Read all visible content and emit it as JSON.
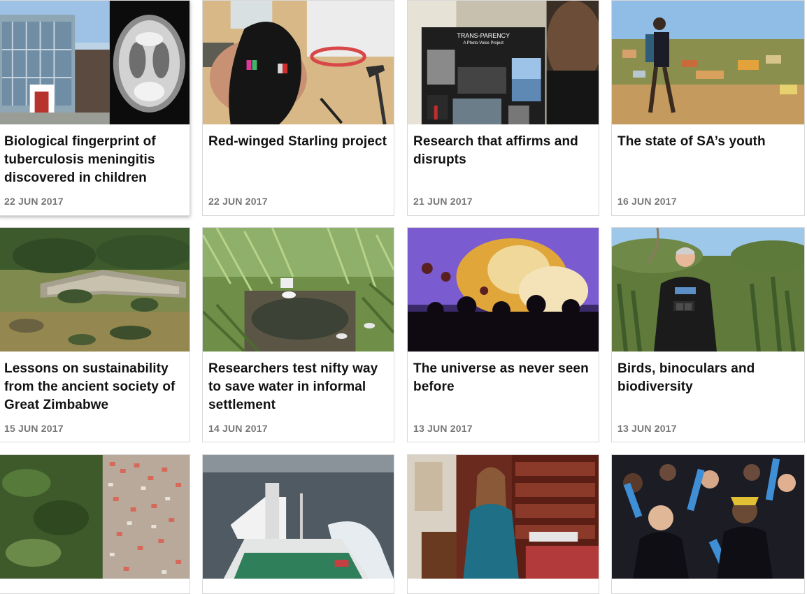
{
  "articles": [
    {
      "title": "Biological fingerprint of tuberculosis meningitis discovered in children",
      "date": "22 JUN 2017",
      "image": "building-and-brain-mri"
    },
    {
      "title": "Red-winged Starling project",
      "date": "22 JUN 2017",
      "image": "bird-in-hand-with-ringing-tools"
    },
    {
      "title": "Research that affirms and disrupts",
      "date": "21 JUN 2017",
      "image": "photo-voice-poster"
    },
    {
      "title": "The state of SA’s youth",
      "date": "16 JUN 2017",
      "image": "child-walking-on-hillside"
    },
    {
      "title": "Lessons on sustainability from the ancient society of Great Zimbabwe",
      "date": "15 JUN 2017",
      "image": "great-zimbabwe-ruins"
    },
    {
      "title": "Researchers test nifty way to save water in informal settlement",
      "date": "14 JUN 2017",
      "image": "grass-and-wastewater"
    },
    {
      "title": "The universe as never seen before",
      "date": "13 JUN 2017",
      "image": "planetarium-audience"
    },
    {
      "title": "Birds, binoculars and biodiversity",
      "date": "13 JUN 2017",
      "image": "man-with-binoculars"
    },
    {
      "image": "aerial-township-and-forest"
    },
    {
      "image": "research-vessel-at-sea"
    },
    {
      "image": "woman-in-library"
    },
    {
      "image": "graduation-ceremony"
    }
  ],
  "poster_text": {
    "line1": "TRANS-PARENCY",
    "line2": "A Photo-Voice Project"
  }
}
